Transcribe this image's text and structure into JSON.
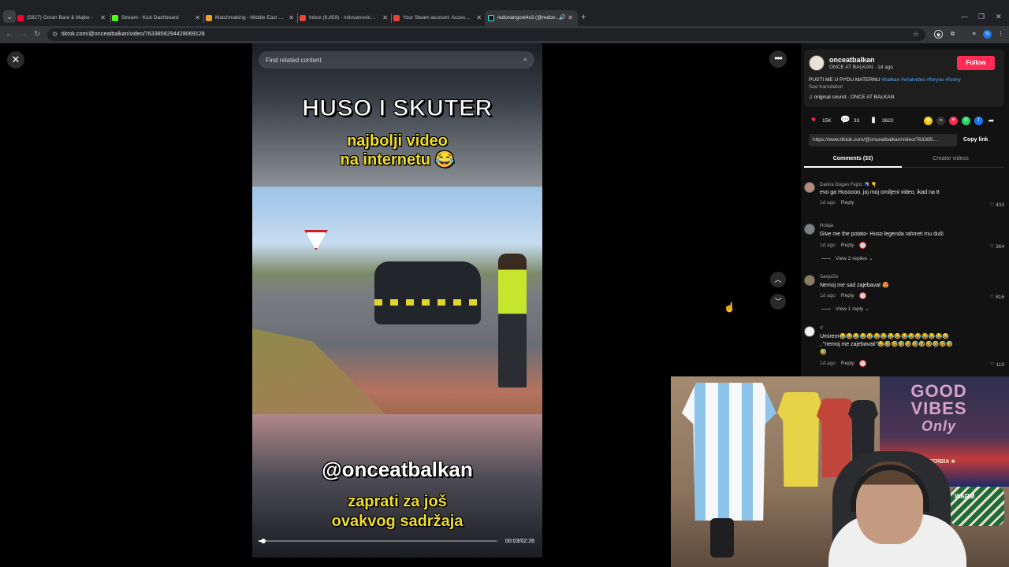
{
  "browser": {
    "tabs": [
      {
        "title": "(5927) Goran Bare & Majke - ",
        "favicon_color": "#ff0033"
      },
      {
        "title": "Stream - Kick Dashboard",
        "favicon_color": "#53fc18"
      },
      {
        "title": "Matchmaking - Middle East Se",
        "favicon_color": "#f2a12d"
      },
      {
        "title": "Inbox (6,859) - milovanovicnen",
        "favicon_color": "#ea4335"
      },
      {
        "title": "Your Steam account: Access fro",
        "favicon_color": "#ea4335"
      },
      {
        "title": "redovangost4x3 (@redovan",
        "favicon_color": "#25f4ee"
      }
    ],
    "url": "tiktok.com/@onceatbalkan/video/7633856294428069128",
    "profile_initial": "N"
  },
  "video": {
    "search_placeholder": "Find related content",
    "caption_title": "HUSO I SKUTER",
    "caption_sub_line1": "najbolji video",
    "caption_sub_line2": "na internetu 😂",
    "handle_overlay": "@onceatbalkan",
    "cta_line1": "zaprati za još",
    "cta_line2": "ovakvog sadržaja",
    "time": "00:03/02:26",
    "progress": 0.02
  },
  "author": {
    "username": "onceatbalkan",
    "display": "ONCE AT BALKAN · 1d ago",
    "follow_label": "Follow",
    "description": "PUSTI ME U PI*DU MATERNU",
    "hashtags": "#balkan #viralvideo #foryou #funny",
    "see_translation": "See translation",
    "sound": "♫  original sound - ONCE AT BALKAN"
  },
  "stats": {
    "likes": "15K",
    "comments": "33",
    "saves": "3622"
  },
  "share": {
    "link": "https://www.tiktok.com/@onceatbalkan/video/763385...",
    "copy_label": "Copy link"
  },
  "tabs": {
    "comments": "Comments (33)",
    "creator": "Creator videos"
  },
  "comments": [
    {
      "user": "Danira Dogan Fejzic 🇧🇦 👇",
      "text": "evo ga Husoooo, joj moj omiljeni video, ikad na tt",
      "time": "1d ago",
      "reply": "Reply",
      "likes": "433"
    },
    {
      "user": "Holaja",
      "text": "Give me the potato- Huso legenda rahmet mu duši",
      "time": "1d ago",
      "reply": "Reply",
      "likes": "364",
      "view_replies": "View 2 replies ⌄"
    },
    {
      "user": "SanjoOo",
      "text": "Nemoj me sad zajebavat 😍",
      "time": "1d ago",
      "reply": "Reply",
      "likes": "816",
      "view_replies": "View 1 reply ⌄"
    },
    {
      "user": "V",
      "text": "Umirem😂😂😂😂😂😂😂😂😂😂😂😂😂😂😂😂",
      "text2": ", \"nemoj me zajebavati\"😂🤣🤣🤣🤣🤣🤣🤣🤣🤣🤣",
      "text3": "🤣",
      "time": "1d ago",
      "reply": "Reply",
      "likes": "119"
    }
  ],
  "webcam": {
    "banner_line1": "GOOD",
    "banner_line2": "VIBES",
    "banner_line3": "Only",
    "banner_sub": "★ SERBIA ★",
    "hat_text": "WARM"
  },
  "colors": {
    "accent": "#fe2c55",
    "hashtag": "#5aa8ff",
    "caption_yellow": "#f0dd2c"
  }
}
